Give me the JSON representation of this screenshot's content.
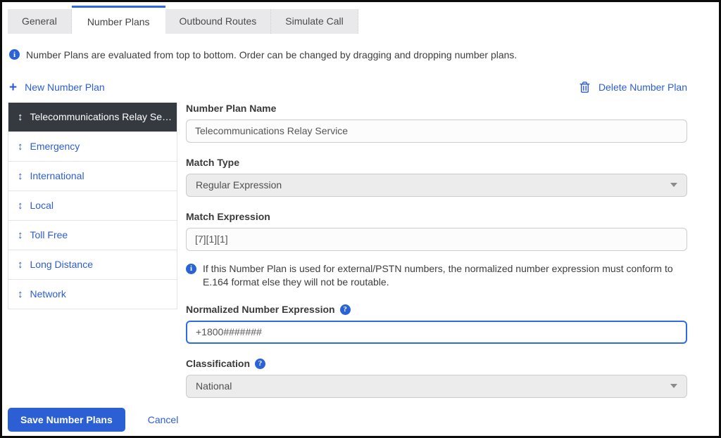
{
  "tabs": [
    {
      "label": "General",
      "active": false
    },
    {
      "label": "Number Plans",
      "active": true
    },
    {
      "label": "Outbound Routes",
      "active": false
    },
    {
      "label": "Simulate Call",
      "active": false
    }
  ],
  "info_banner": {
    "text": "Number Plans are evaluated from top to bottom. Order can be changed by dragging and dropping number plans."
  },
  "toolbar": {
    "new_plan_label": "New Number Plan",
    "delete_plan_label": "Delete Number Plan"
  },
  "plan_list": {
    "items": [
      {
        "label": "Telecommunications Relay Se…",
        "selected": true
      },
      {
        "label": "Emergency",
        "selected": false
      },
      {
        "label": "International",
        "selected": false
      },
      {
        "label": "Local",
        "selected": false
      },
      {
        "label": "Toll Free",
        "selected": false
      },
      {
        "label": "Long Distance",
        "selected": false
      },
      {
        "label": "Network",
        "selected": false
      }
    ]
  },
  "form": {
    "name": {
      "label": "Number Plan Name",
      "value": "Telecommunications Relay Service"
    },
    "match_type": {
      "label": "Match Type",
      "value": "Regular Expression"
    },
    "match_expression": {
      "label": "Match Expression",
      "value": "[7][1][1]"
    },
    "note": "If this Number Plan is used for external/PSTN numbers, the normalized number expression must conform to E.164 format else they will not be routable.",
    "normalized": {
      "label": "Normalized Number Expression",
      "value": "+1800#######"
    },
    "classification": {
      "label": "Classification",
      "value": "National"
    }
  },
  "footer": {
    "save_label": "Save Number Plans",
    "cancel_label": "Cancel"
  },
  "icons": {
    "drag_reorder": "↕",
    "plus": "+",
    "info": "i",
    "help": "?"
  },
  "colors": {
    "accent_blue": "#2c5cd8",
    "tab_active_border": "#2a68e8",
    "selected_item_bg": "#343a40",
    "save_button_bg": "#2b5fd3",
    "focused_input_border": "#2e6be6"
  }
}
